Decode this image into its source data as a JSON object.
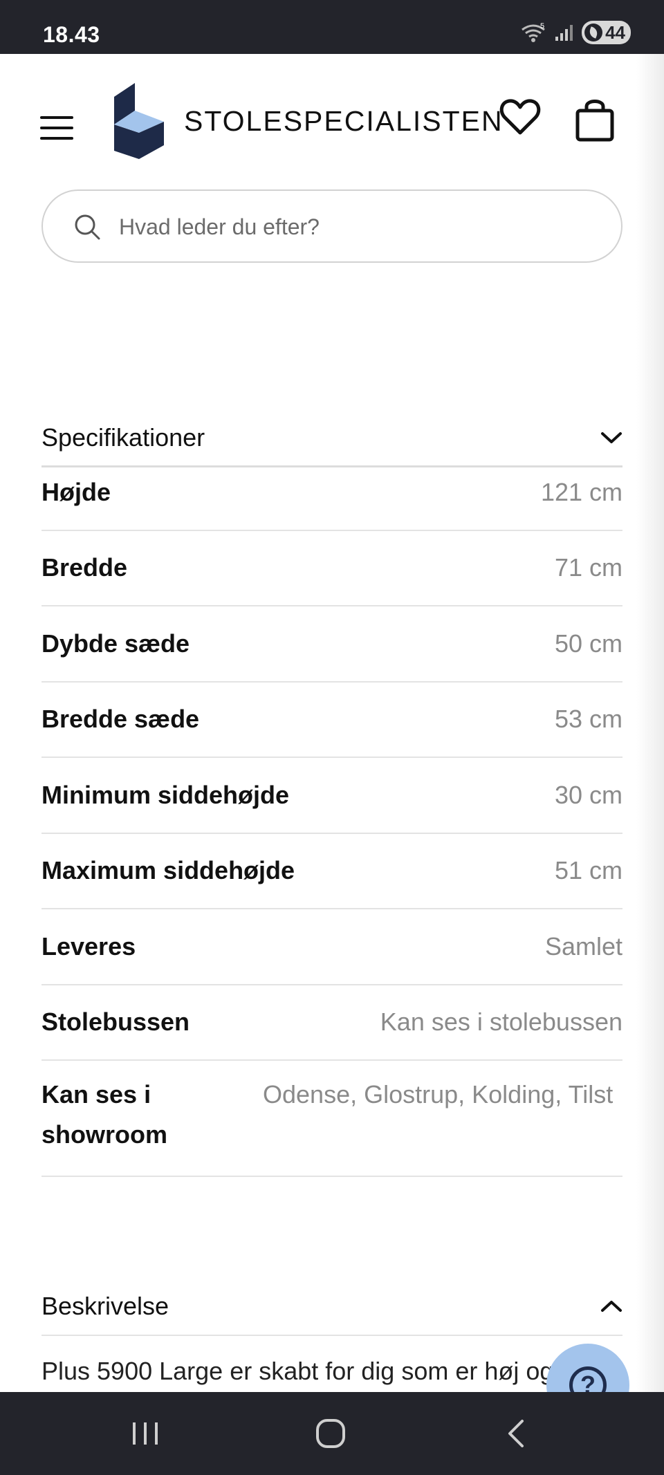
{
  "status_bar": {
    "time": "18.43",
    "battery": "44",
    "wifi_badge": "5"
  },
  "header": {
    "brand": "STOLESPECIALISTEN",
    "logo_colors": {
      "dark": "#1e2a48",
      "light": "#a3c4ec"
    }
  },
  "search": {
    "placeholder": "Hvad leder du efter?"
  },
  "specs": {
    "title": "Specifikationer",
    "rows": [
      {
        "label": "Højde",
        "value": "121 cm"
      },
      {
        "label": "Bredde",
        "value": "71 cm"
      },
      {
        "label": "Dybde sæde",
        "value": "50 cm"
      },
      {
        "label": "Bredde sæde",
        "value": "53 cm"
      },
      {
        "label": "Minimum siddehøjde",
        "value": "30 cm"
      },
      {
        "label": "Maximum siddehøjde",
        "value": "51 cm"
      },
      {
        "label": "Leveres",
        "value": "Samlet"
      },
      {
        "label": "Stolebussen",
        "value": "Kan ses i stolebussen"
      },
      {
        "label": "Kan ses i showroom",
        "value": "Odense, Glostrup, Kolding, Tilst"
      }
    ]
  },
  "description": {
    "title": "Beskrivelse",
    "text": "Plus 5900 Large er skabt for dig som er høj og"
  },
  "help": {
    "label": "?",
    "color": "#a3c4ec"
  },
  "icons": {
    "menu": "hamburger-menu-icon",
    "heart": "heart-icon",
    "bag": "shopping-bag-icon",
    "search": "search-icon",
    "help": "question-icon"
  }
}
